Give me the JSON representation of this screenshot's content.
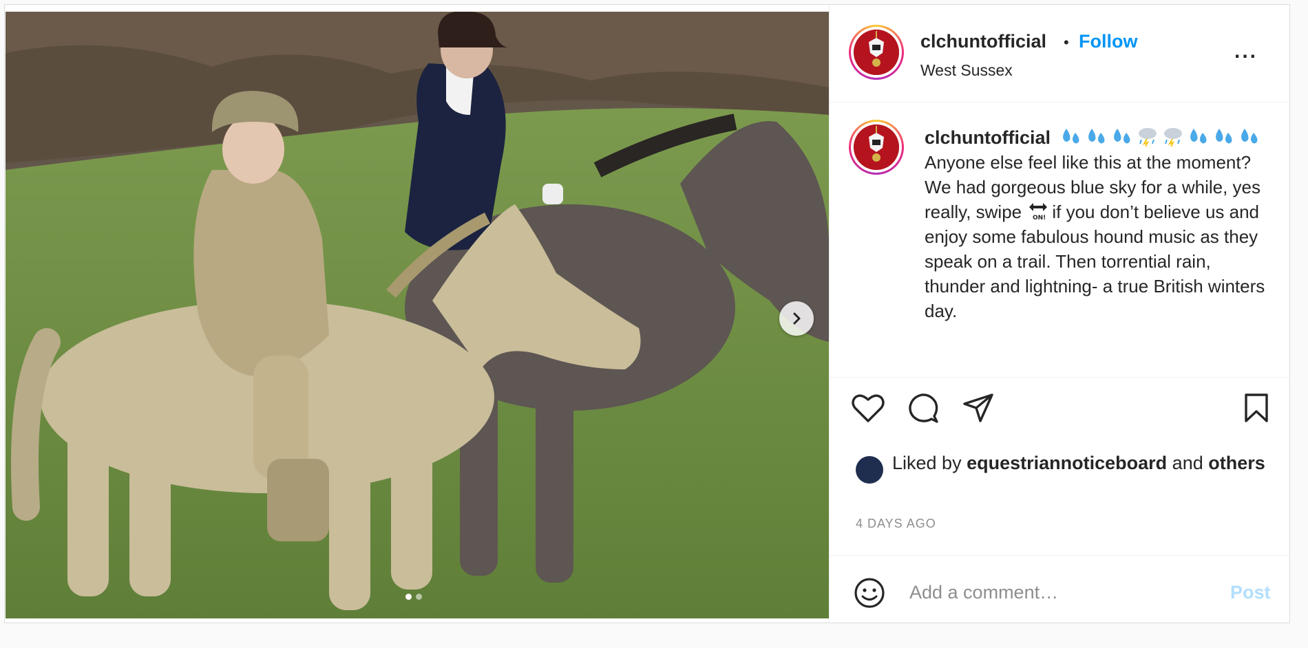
{
  "post": {
    "author": "clchuntofficial",
    "bullet": "•",
    "follow_label": "Follow",
    "location": "West Sussex",
    "more_label": "...",
    "caption": {
      "username": "clchuntofficial",
      "lines": [
        "Anyone else feel like this at the moment?",
        "We had gorgeous blue sky for a while, yes really, swipe",
        "if you don’t believe us and enjoy some fabulous hound music as they speak on a trail. Then torrential rain, thunder and lightning- a true British winters day."
      ]
    },
    "likes": {
      "prefix": "Liked by",
      "user": "equestriannoticeboard",
      "joiner": "and",
      "others": "others"
    },
    "timestamp": "4 DAYS AGO",
    "carousel": {
      "slides": 2,
      "active_slide": 1
    }
  },
  "comment": {
    "placeholder": "Add a comment…",
    "post_label": "Post"
  },
  "icons": {
    "avatar": "hunt-crest-avatar",
    "next": "chevron-right-icon",
    "like": "heart-icon",
    "comment": "speech-bubble-icon",
    "share": "paper-plane-icon",
    "save": "bookmark-icon",
    "emoji": "smiley-icon"
  },
  "colors": {
    "accent": "#0095f6",
    "post_disabled": "#b2dffc",
    "muted": "#8e8e8e",
    "border": "#dbdbdb"
  }
}
